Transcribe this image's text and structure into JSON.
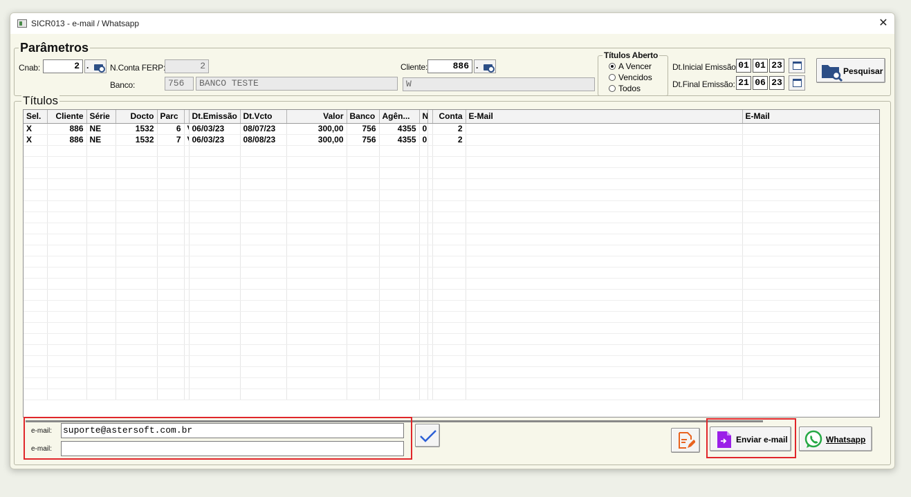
{
  "window": {
    "title": "SICR013 - e-mail / Whatsapp",
    "close_glyph": "✕"
  },
  "parametros": {
    "title": "Parâmetros",
    "cnab_label": "Cnab:",
    "cnab_value": "2",
    "lookup_dot": ".",
    "nconta_label": "N.Conta FERP:",
    "nconta_value": "2",
    "banco_label": "Banco:",
    "banco_code": "756",
    "banco_name": "BANCO TESTE",
    "cliente_label": "Cliente:",
    "cliente_value": "886",
    "cliente_name": "W",
    "titulos_aberto": {
      "title": "Títulos Aberto",
      "options": [
        "A Vencer",
        "Vencidos",
        "Todos"
      ],
      "selected": "A Vencer"
    },
    "dt_inicial_label": "Dt.Inicial Emissão:",
    "dt_inicial": [
      "01",
      "01",
      "23"
    ],
    "dt_final_label": "Dt.Final Emissão:",
    "dt_final": [
      "21",
      "06",
      "23"
    ],
    "pesquisar_label": "Pesquisar"
  },
  "titulos": {
    "title": "Títulos",
    "columns": [
      "Sel.",
      "Cliente",
      "Série",
      "Docto",
      "Parc",
      "",
      "Dt.Emissão",
      "Dt.Vcto",
      "Valor",
      "Banco",
      "Agên...",
      "N",
      "",
      "Conta",
      "E-Mail",
      "E-Mail"
    ],
    "rows": [
      [
        "X",
        "886",
        "NE",
        "1532",
        "6",
        "V",
        "06/03/23",
        "08/07/23",
        "300,00",
        "756",
        "4355",
        "0",
        "",
        "2",
        "",
        ""
      ],
      [
        "X",
        "886",
        "NE",
        "1532",
        "7",
        "V",
        "06/03/23",
        "08/08/23",
        "300,00",
        "756",
        "4355",
        "0",
        "",
        "2",
        "",
        ""
      ]
    ]
  },
  "email_panel": {
    "email1_label": "e-mail:",
    "email1_value": "suporte@astersoft.com.br",
    "email2_label": "e-mail:",
    "email2_value": ""
  },
  "actions": {
    "enviar_email_label": "Enviar e-mail",
    "whatsapp_label": "Whatsapp"
  },
  "colors": {
    "highlight": "#e0262a",
    "icon_blue": "#2c4e86",
    "enviar_icon": "#9b1fe8",
    "whatsapp": "#25a844",
    "edit_icon": "#e8631f"
  }
}
